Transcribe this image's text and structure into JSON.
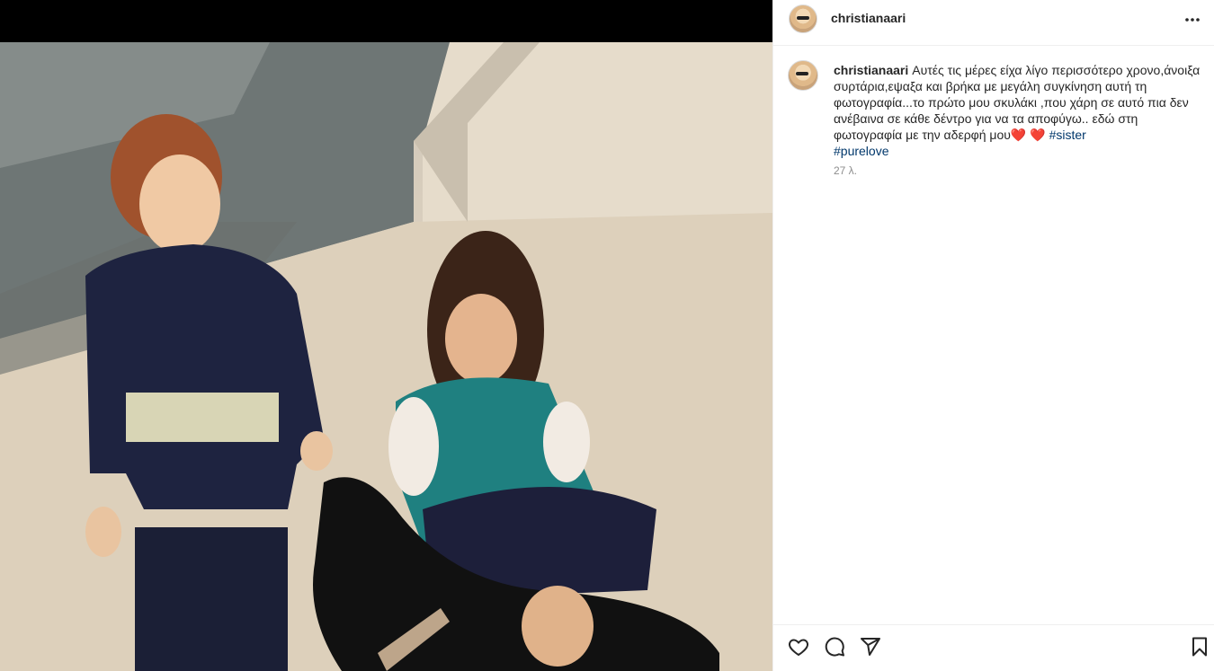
{
  "post": {
    "username": "christianaari",
    "caption": {
      "username": "christianaari",
      "text": "Αυτές τις μέρες είχα λίγο περισσότερο χρονο,άνοιξα συρτάρια,εψαξα και βρήκα με μεγάλη συγκίνηση αυτή τη φωτογραφία...το πρώτο μου σκυλάκι ,που χάρη σε αυτό πια δεν ανέβαινα σε κάθε δέντρο για να τα αποφύγω.. εδώ στη φωτογραφία με την αδερφή μου",
      "emoji": "❤️ ❤️",
      "hashtags": [
        "#sister",
        "#purelove"
      ]
    },
    "timestamp": "27 λ."
  },
  "icons": {
    "more": "more-icon",
    "like": "heart-icon",
    "comment": "comment-icon",
    "share": "share-icon",
    "save": "bookmark-icon"
  },
  "colors": {
    "hashtag": "#00376b",
    "heart": "#ed1c24",
    "meta": "#8e8e8e"
  }
}
